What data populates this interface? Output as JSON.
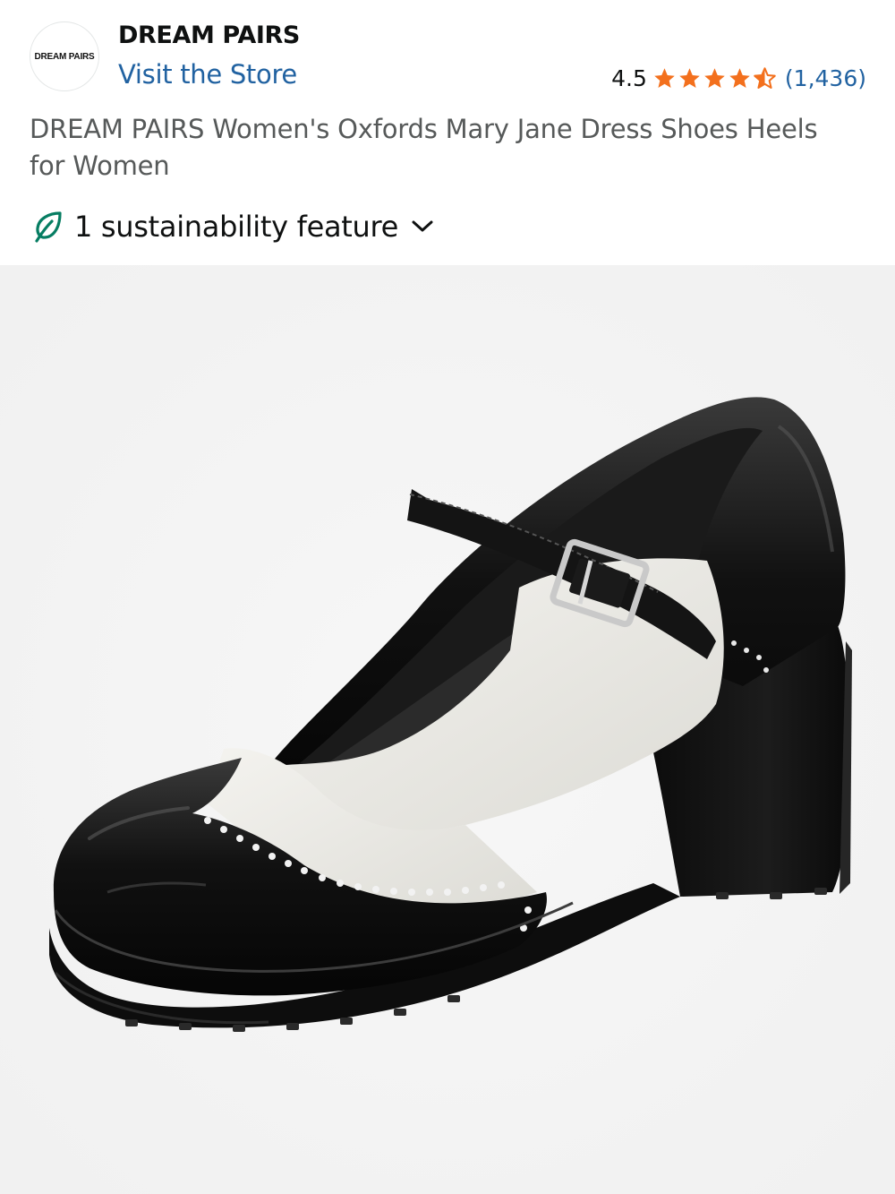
{
  "brand": {
    "logo_text": "DREAM PAIRS",
    "name": "DREAM PAIRS",
    "store_link": "Visit the Store"
  },
  "rating": {
    "value": "4.5",
    "stars": 4.5,
    "count": "(1,436)",
    "star_color": "#f3701d"
  },
  "product": {
    "title": "DREAM PAIRS Women's Oxfords Mary Jane Dress Shoes Heels for Women"
  },
  "sustainability": {
    "label": "1 sustainability feature",
    "icon": "leaf-icon",
    "toggle_icon": "chevron-down-icon"
  },
  "image": {
    "alt": "Black and white Mary Jane wingtip heel shoe",
    "background": "#f2f2f2"
  },
  "colors": {
    "link": "#2162a1",
    "text": "#0f1111",
    "muted": "#565959",
    "leaf": "#067d62"
  }
}
